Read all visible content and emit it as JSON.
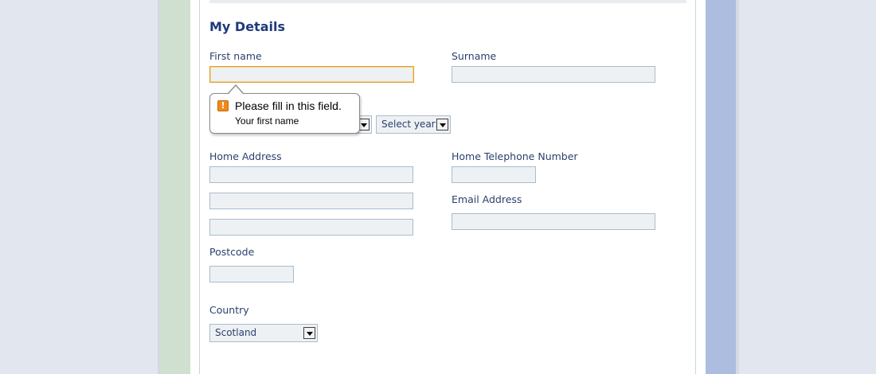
{
  "section_title": "My Details",
  "first_name": {
    "label": "First name",
    "value": ""
  },
  "surname": {
    "label": "Surname",
    "value": ""
  },
  "validation_tooltip": {
    "title": "Please fill in this field.",
    "subtitle": "Your first name",
    "icon": "warning-icon",
    "icon_color": "#f08a1c"
  },
  "dob": {
    "year_select": {
      "value": "Select year:"
    }
  },
  "home_address": {
    "label": "Home Address",
    "lines": [
      "",
      "",
      ""
    ]
  },
  "home_telephone": {
    "label": "Home Telephone Number",
    "value": ""
  },
  "email": {
    "label": "Email Address",
    "value": ""
  },
  "postcode": {
    "label": "Postcode",
    "value": ""
  },
  "country": {
    "label": "Country",
    "value": "Scotland"
  },
  "colors": {
    "title": "#1f3a7a",
    "label": "#2b3f6e",
    "left_column": "#d0e0d0",
    "right_column": "#adbde0",
    "field_bg": "#eef1f3",
    "focus_border": "#e0a030"
  }
}
